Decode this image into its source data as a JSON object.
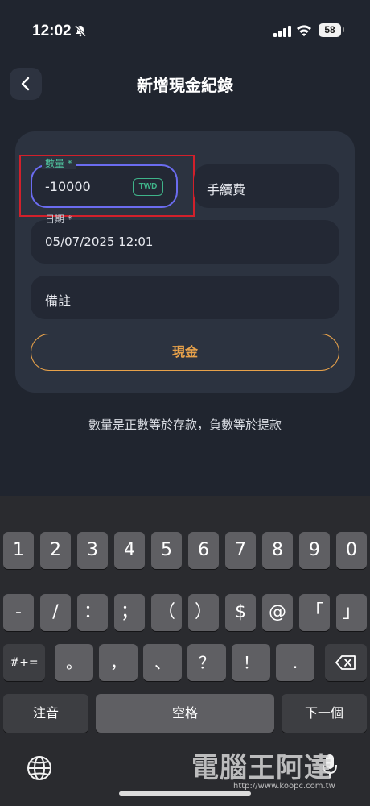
{
  "status_bar": {
    "time": "12:02",
    "battery": "58"
  },
  "header": {
    "title": "新增現金紀錄"
  },
  "form": {
    "amount_label": "數量 *",
    "amount_value": "-10000",
    "currency": "TWD",
    "fee_placeholder": "手續費",
    "date_label": "日期 *",
    "date_value": "05/07/2025 12:01",
    "note_placeholder": "備註",
    "type_button": "現金",
    "hint": "數量是正數等於存款，負數等於提款"
  },
  "keyboard": {
    "row1": [
      "1",
      "2",
      "3",
      "4",
      "5",
      "6",
      "7",
      "8",
      "9",
      "0"
    ],
    "row2": [
      "-",
      "/",
      "：",
      "；",
      "（",
      "）",
      "$",
      "@",
      "「",
      "」"
    ],
    "row3": [
      "#+=",
      "。",
      "，",
      "、",
      "？",
      "！",
      "."
    ],
    "row4": {
      "left": "注音",
      "space": "空格",
      "next": "下一個"
    }
  },
  "watermark": {
    "text": "電腦王阿達",
    "url": "http://www.koopc.com.tw"
  },
  "colors": {
    "accent_focus": "#6b6cf0",
    "label_green": "#51c7a0",
    "cash_orange": "#e8a24a",
    "highlight_red": "#d2202b"
  }
}
